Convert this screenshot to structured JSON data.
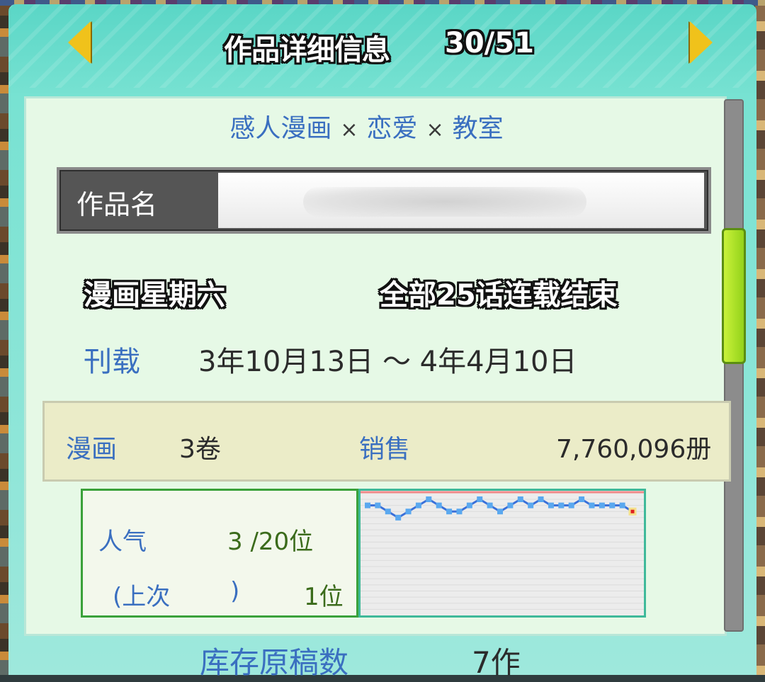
{
  "header": {
    "title": "作品详细信息",
    "page": "30/51"
  },
  "genres": [
    "感人漫画",
    "恋爱",
    "教室"
  ],
  "genre_separator": "×",
  "work": {
    "name_label": "作品名",
    "name_value": "",
    "serial_day": "漫画星期六",
    "serial_status": "全部25话连载结束"
  },
  "publication": {
    "label": "刊载",
    "period": "3年10月13日 ～ 4年4月10日"
  },
  "sales": {
    "comic_label": "漫画",
    "comic_volumes": "3卷",
    "sales_label": "销售",
    "sales_value": "7,760,096册"
  },
  "popularity": {
    "label": "人气",
    "rank": "3 /20位",
    "previous_open": "(上次",
    "previous_close": ")",
    "previous_rank": "1位"
  },
  "chart_data": {
    "type": "line",
    "ylim": [
      1,
      20
    ],
    "series": [
      {
        "color": "#3a6fd8",
        "values": [
          2,
          2,
          3,
          4,
          3,
          2,
          1,
          2,
          3,
          3,
          2,
          1,
          2,
          3,
          2,
          1,
          2,
          1,
          2,
          2,
          2,
          1,
          2,
          2,
          2,
          2,
          3
        ]
      }
    ],
    "latest_marker_color": "#e02020"
  },
  "stock": {
    "label": "库存原稿数",
    "value": "7作"
  },
  "icons": {
    "prev": "arrow-left-icon",
    "next": "arrow-right-icon"
  }
}
